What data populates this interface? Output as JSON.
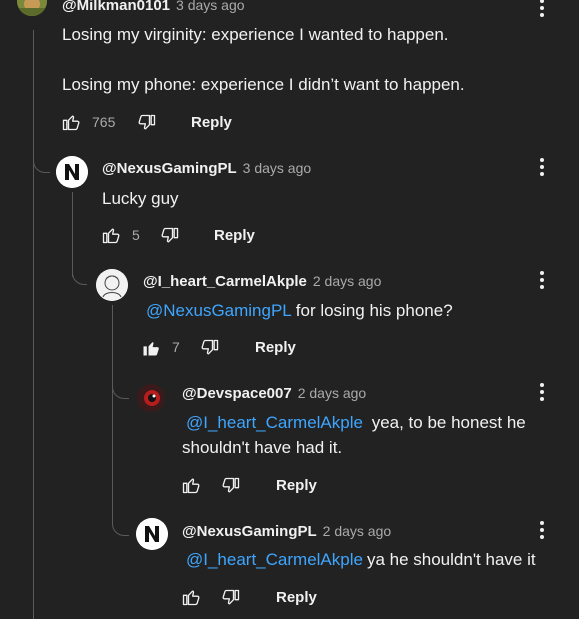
{
  "comments": [
    {
      "author": "@Milkman0101",
      "time": "3 days ago",
      "lines": [
        "Losing my virginity: experience I wanted to happen.",
        "Losing my phone: experience I didn’t want to happen."
      ],
      "likes": "765",
      "reply": "Reply",
      "avatar_icon": "profile-photo"
    },
    {
      "author": "@NexusGamingPL",
      "time": "3 days ago",
      "text": "Lucky guy",
      "likes": "5",
      "reply": "Reply",
      "avatar_icon": "n-logo"
    },
    {
      "author": "@I_heart_CarmelAkple",
      "time": "2 days ago",
      "mention": "@NexusGamingPL",
      "text": "for losing his phone?",
      "likes": "7",
      "reply": "Reply",
      "liked": true,
      "avatar_icon": "sketch-avatar"
    },
    {
      "author": "@Devspace007",
      "time": "2 days ago",
      "mention": "@I_heart_CarmelAkple",
      "text_line1": "yea, to be honest he",
      "text_line2": "shouldn't have had it.",
      "reply": "Reply",
      "avatar_icon": "red-black-avatar"
    },
    {
      "author": "@NexusGamingPL",
      "time": "2 days ago",
      "mention": "@I_heart_CarmelAkple",
      "text": "ya he shouldn't have it",
      "reply": "Reply",
      "avatar_icon": "n-logo"
    }
  ],
  "colors": {
    "background": "#222222",
    "mention": "#3ea6ff",
    "muted": "#aaaaaa",
    "text": "#f1f1f1"
  }
}
